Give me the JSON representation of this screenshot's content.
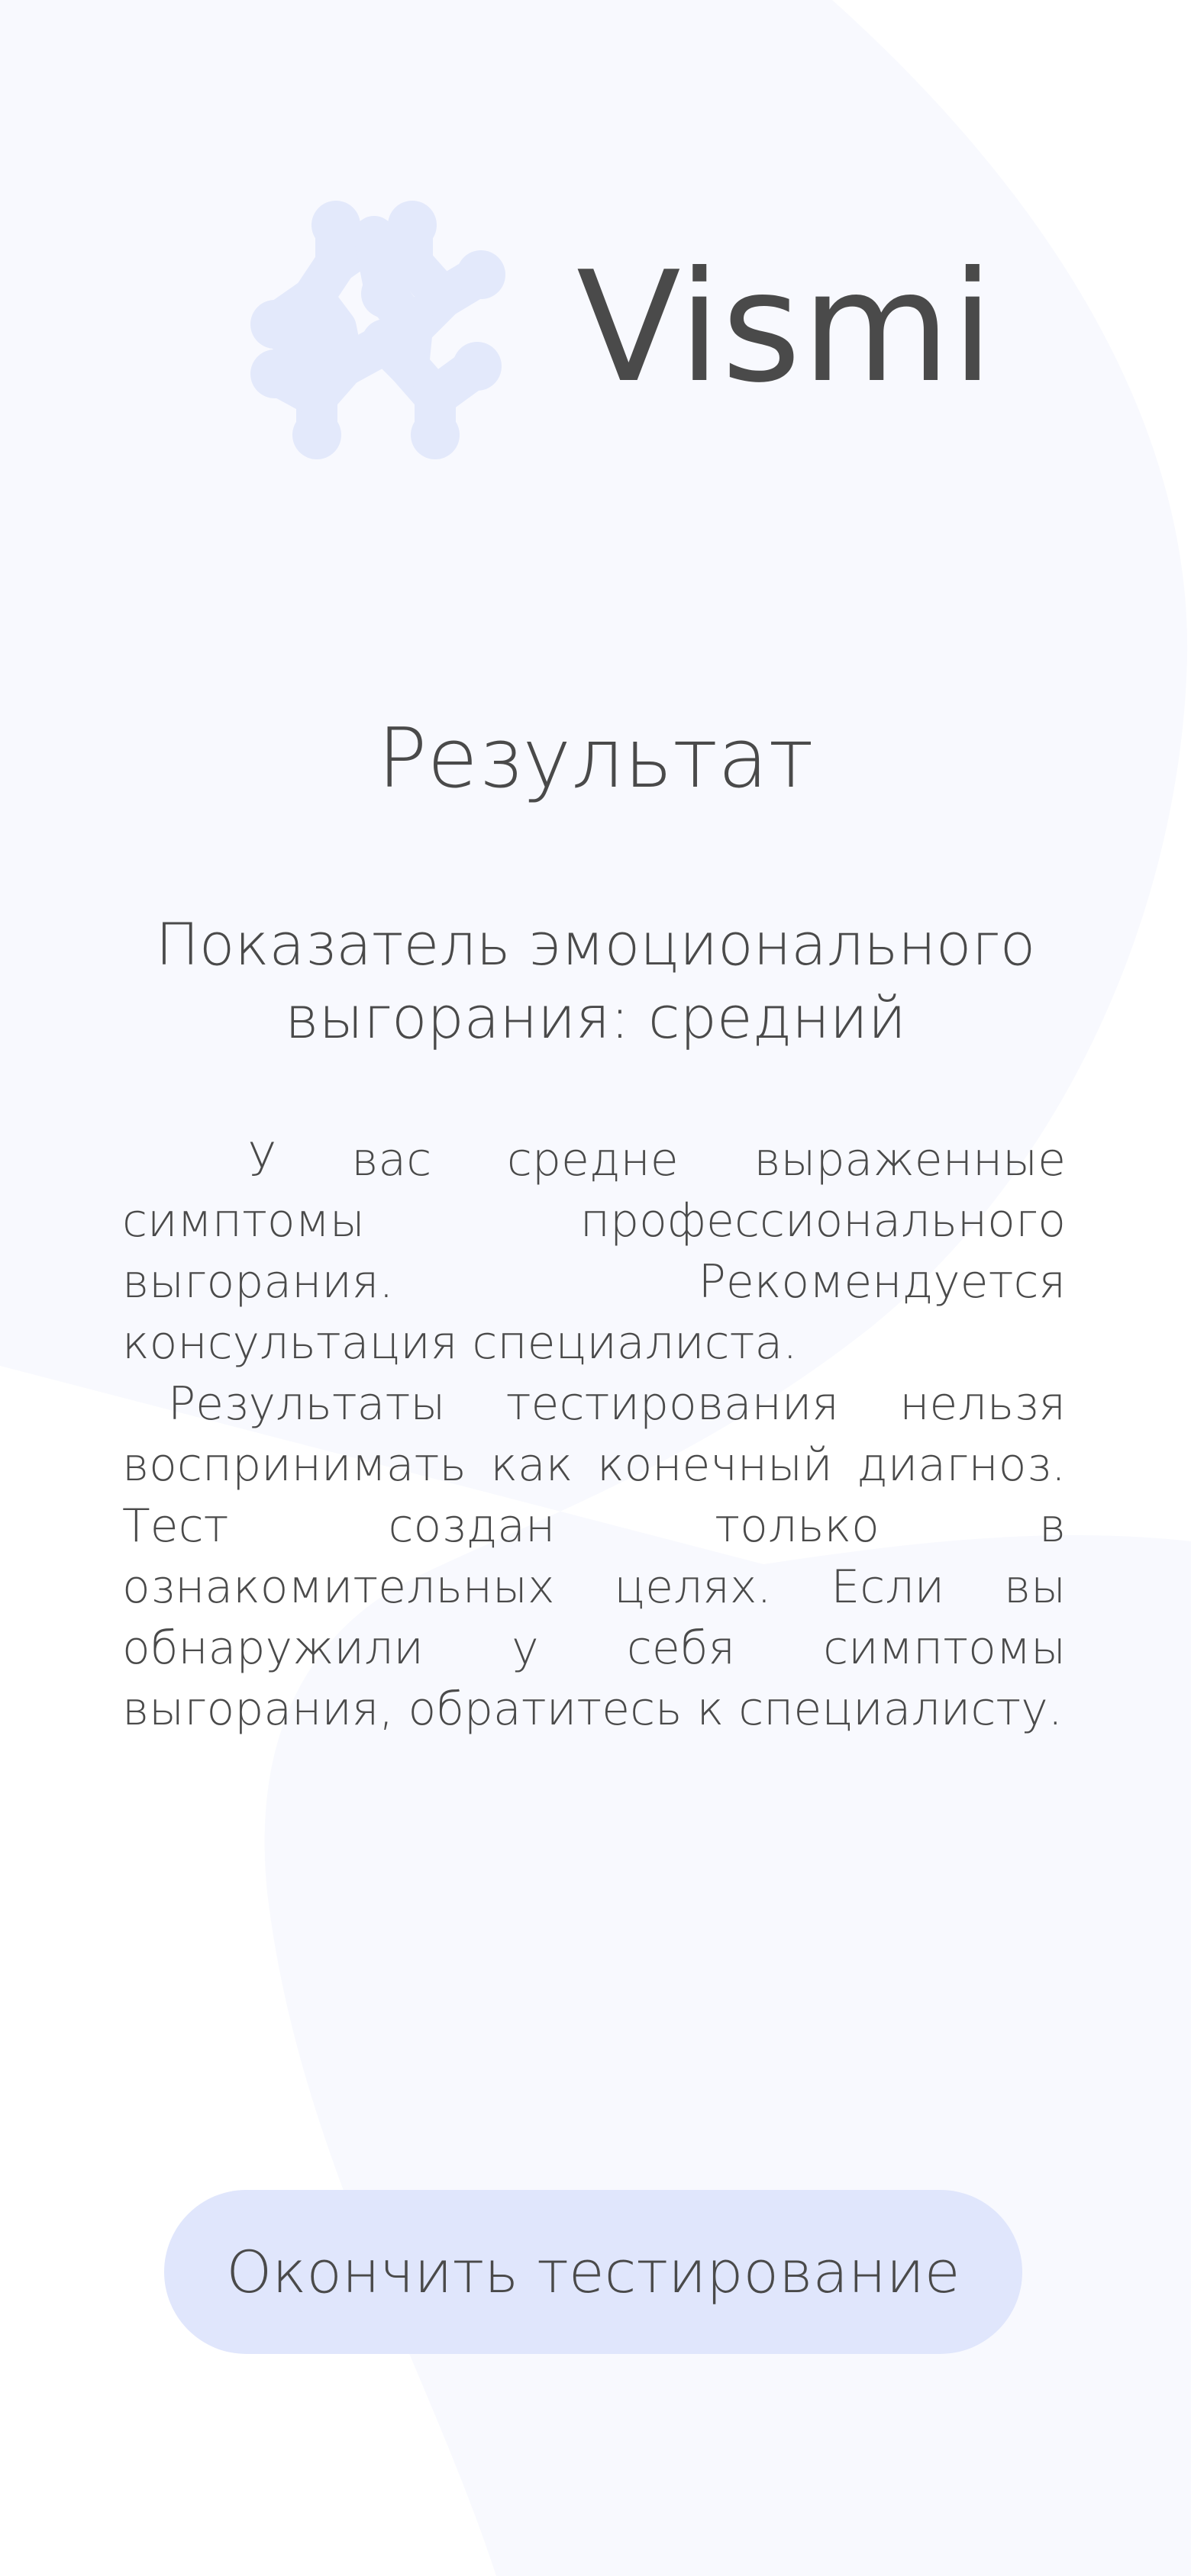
{
  "app": {
    "logo_text": "Vismi",
    "logo_icon": "molecule-logo-icon"
  },
  "result": {
    "title": "Результат",
    "level_line": "Показатель эмоционального выгорания: средний",
    "paragraph_1": "У вас средне выраженные симптомы профессионального выгорания. Рекомендуется консультация специалиста.",
    "paragraph_2": "Результаты тестирования нельзя воспринимать как конечный диагноз. Тест создан только в ознакомительных целях. Если вы обнаружили у себя симптомы выгорания, обратитесь к специалисту."
  },
  "actions": {
    "finish_label": "Окончить тестирование"
  },
  "colors": {
    "text": "#4a4a4a",
    "button_bg": "#e0e6fc",
    "logo_mark": "#e3e9fb",
    "background_shape": "#f8f9fe"
  }
}
